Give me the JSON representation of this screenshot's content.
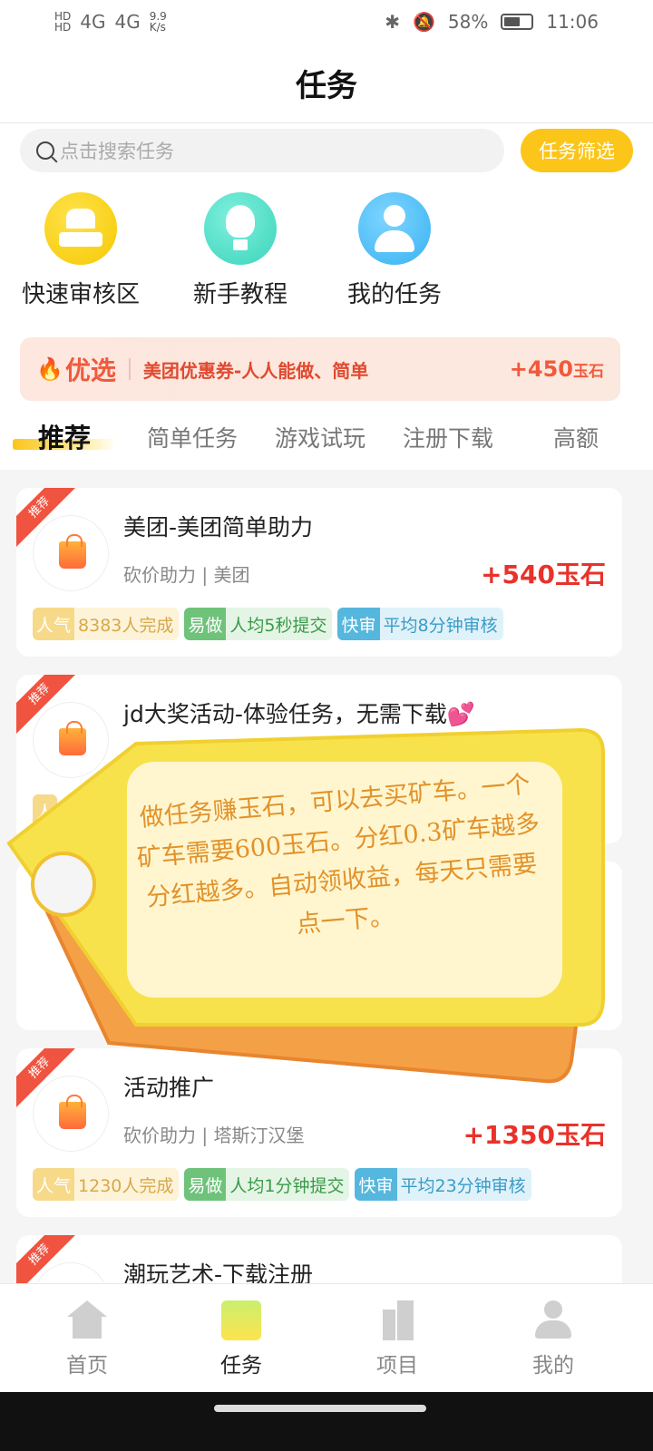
{
  "status_bar": {
    "net1": "HD",
    "net2": "HD",
    "signal1": "4G",
    "signal2": "4G",
    "speed": "9.9",
    "speed_unit": "K/s",
    "battery": "58%",
    "time": "11:06",
    "battery_level": 0.58
  },
  "header": {
    "title": "任务"
  },
  "search": {
    "placeholder": "点击搜索任务",
    "filter_label": "任务筛选"
  },
  "quick_actions": [
    {
      "label": "快速审核区",
      "icon": "stamp-icon"
    },
    {
      "label": "新手教程",
      "icon": "lightbulb-icon"
    },
    {
      "label": "我的任务",
      "icon": "user-icon"
    }
  ],
  "promo": {
    "tag": "优选",
    "text": "美团优惠券-人人能做、简单",
    "reward_value": "+450",
    "reward_unit": "玉石"
  },
  "tabs": [
    "推荐",
    "简单任务",
    "游戏试玩",
    "注册下载",
    "高额"
  ],
  "tasks": [
    {
      "ribbon": "推荐",
      "title": "美团-美团简单助力",
      "subtitle": "砍价助力 | 美团",
      "reward": "+540玉石",
      "tags": {
        "pop_k": "人气",
        "pop_v": "8383人完成",
        "easy_k": "易做",
        "easy_v": "人均5秒提交",
        "fast_k": "快审",
        "fast_v": "平均8分钟审核"
      }
    },
    {
      "ribbon": "推荐",
      "title": "jd大奖活动-体验任务，无需下载💕",
      "subtitle": "",
      "reward": "",
      "tags": {
        "pop_k": "人",
        "pop_v": "",
        "easy_k": "",
        "easy_v": "",
        "fast_k": "",
        "fast_v": ""
      }
    },
    {
      "ribbon": "推荐",
      "title": "活动推广",
      "subtitle": "砍价助力 | 塔斯汀汉堡",
      "reward": "+1350玉石",
      "tags": {
        "pop_k": "人气",
        "pop_v": "1230人完成",
        "easy_k": "易做",
        "easy_v": "人均1分钟提交",
        "fast_k": "快审",
        "fast_v": "平均23分钟审核"
      }
    },
    {
      "ribbon": "推荐",
      "title": "潮玩艺术-下载注册"
    }
  ],
  "overlay": {
    "text": "做任务赚玉石，可以去买矿车。一个矿车需要600玉石。分红0.3矿车越多分红越多。自动领收益，每天只需要点一下。"
  },
  "bottom_nav": [
    {
      "label": "首页",
      "icon": "home-icon"
    },
    {
      "label": "任务",
      "icon": "task-icon"
    },
    {
      "label": "项目",
      "icon": "building-icon"
    },
    {
      "label": "我的",
      "icon": "profile-icon"
    }
  ],
  "colors": {
    "accent": "#fbc51a",
    "reward": "#e8322a",
    "promo": "#f05a3c"
  }
}
